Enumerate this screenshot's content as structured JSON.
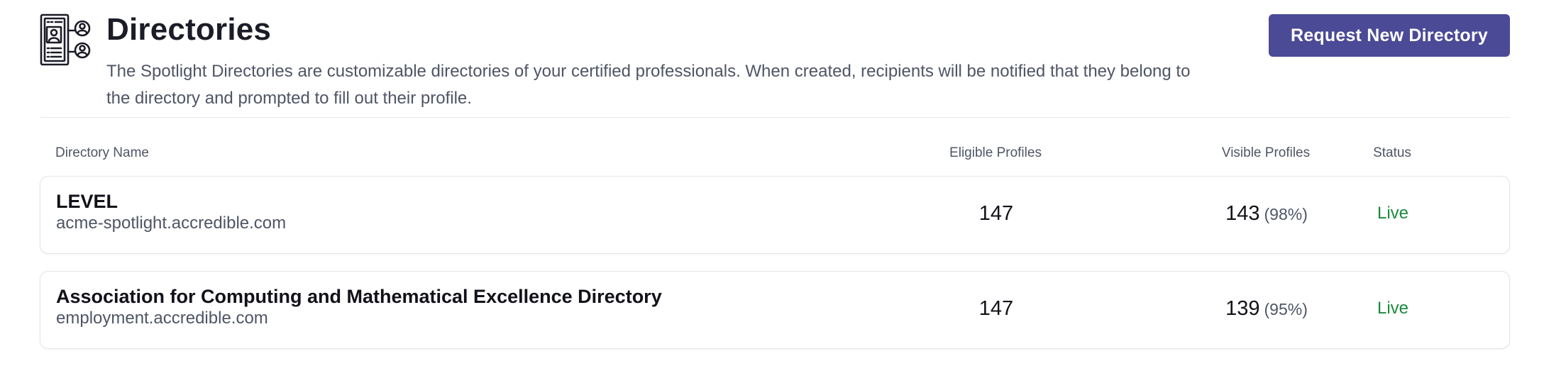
{
  "header": {
    "icon": "directory-profiles-icon",
    "title": "Directories",
    "description": "The Spotlight Directories are customizable directories of your certified professionals. When created, recipients will be notified that they belong to the directory and prompted to fill out their profile.",
    "request_button_label": "Request New Directory"
  },
  "table": {
    "columns": {
      "name": "Directory Name",
      "eligible": "Eligible Profiles",
      "visible": "Visible Profiles",
      "status": "Status"
    },
    "rows": [
      {
        "name": "LEVEL",
        "url": "acme-spotlight.accredible.com",
        "eligible": "147",
        "visible": "143",
        "visible_pct": "(98%)",
        "status": "Live"
      },
      {
        "name": "Association for Computing and Mathematical Excellence Directory",
        "url": "employment.accredible.com",
        "eligible": "147",
        "visible": "139",
        "visible_pct": "(95%)",
        "status": "Live"
      }
    ]
  },
  "colors": {
    "accent": "#4a4a96",
    "status_live": "#1a8a3e",
    "text_muted": "#4f5565"
  }
}
